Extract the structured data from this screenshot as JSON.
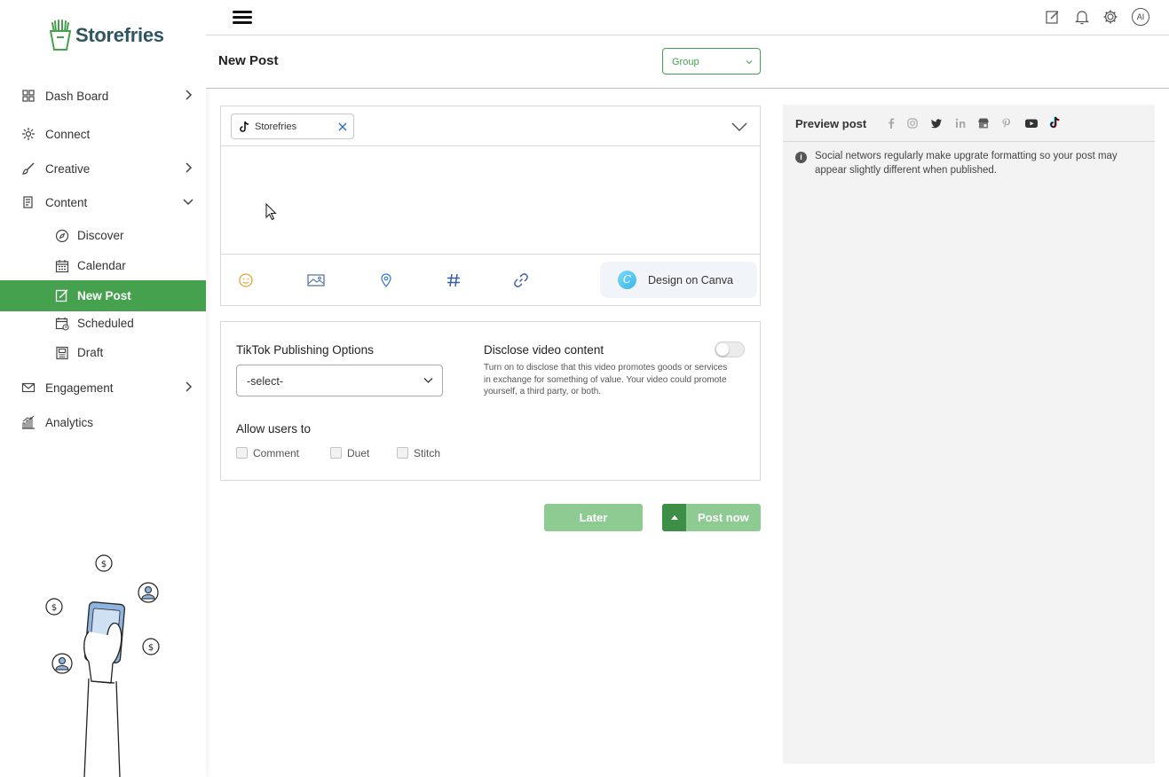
{
  "brand": {
    "name": "Storefries",
    "accent": "#46a14e"
  },
  "sidebar": {
    "items": [
      {
        "label": "Dash Board",
        "icon": "dashboard-icon",
        "chevron": "right"
      },
      {
        "label": "Connect",
        "icon": "connect-icon"
      },
      {
        "label": "Creative",
        "icon": "brush-icon",
        "chevron": "right"
      },
      {
        "label": "Content",
        "icon": "content-icon",
        "chevron": "down"
      },
      {
        "label": "Engagement",
        "icon": "mail-icon",
        "chevron": "right"
      },
      {
        "label": "Analytics",
        "icon": "analytics-icon"
      }
    ],
    "content_sub": [
      {
        "label": "Discover",
        "icon": "compass-icon"
      },
      {
        "label": "Calendar",
        "icon": "calendar-icon"
      },
      {
        "label": "New Post",
        "icon": "edit-icon",
        "active": true
      },
      {
        "label": "Scheduled",
        "icon": "scheduled-icon"
      },
      {
        "label": "Draft",
        "icon": "draft-icon"
      }
    ]
  },
  "topbar": {
    "avatar": "AI"
  },
  "header": {
    "title": "New Post",
    "group_select": "Group"
  },
  "editor": {
    "account_chip": "Storefries",
    "canva_label": "Design on Canva"
  },
  "options": {
    "publishing_title": "TikTok Publishing Options",
    "select_value": "-select-",
    "disclose_title": "Disclose video content",
    "disclose_desc": "Turn on to disclose that this video promotes goods or services in exchange for something of value. Your video could promote yourself, a third party, or both.",
    "disclose_on": false,
    "allow_title": "Allow users to",
    "allow": [
      {
        "label": "Comment",
        "checked": false
      },
      {
        "label": "Duet",
        "checked": false
      },
      {
        "label": "Stitch",
        "checked": false
      }
    ]
  },
  "actions": {
    "later": "Later",
    "post_now": "Post now"
  },
  "preview": {
    "title": "Preview post",
    "networks": [
      "facebook-icon",
      "instagram-icon",
      "twitter-icon",
      "linkedin-icon",
      "google-business-icon",
      "pinterest-icon",
      "youtube-icon",
      "tiktok-icon"
    ],
    "note": "Social networs regularly make upgrate formatting so your post may appear slightly different when published."
  }
}
